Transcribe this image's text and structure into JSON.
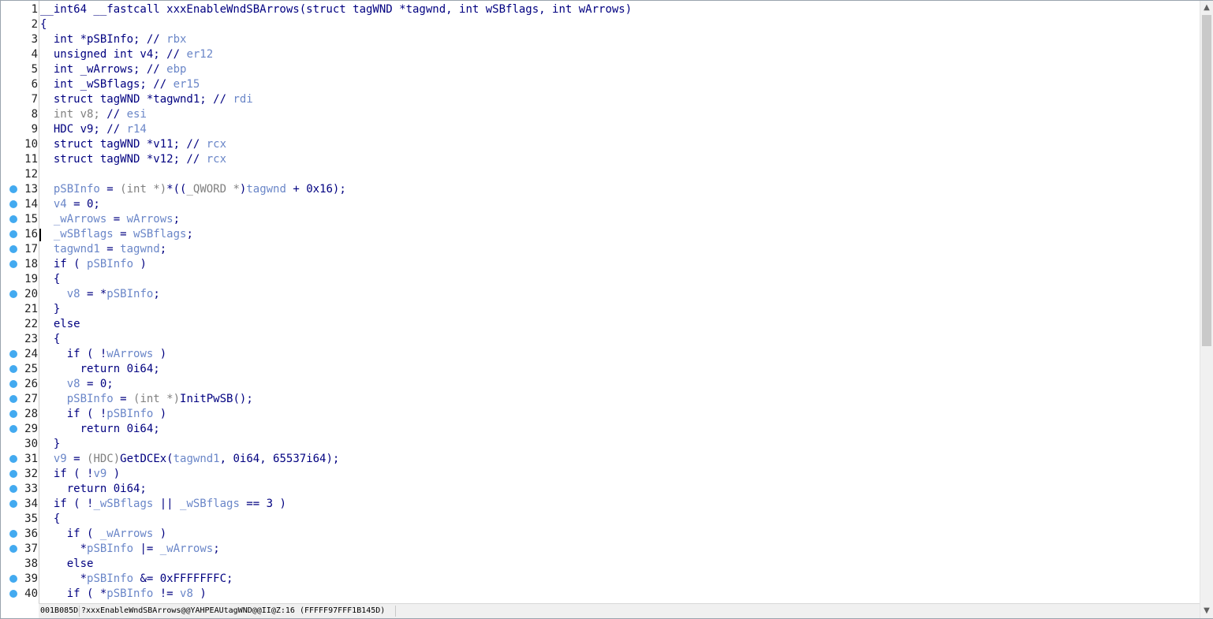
{
  "editor": {
    "lines": [
      {
        "n": "1",
        "bp": false,
        "tokens": [
          [
            "k",
            "__int64 __fastcall xxxEnableWndSBArrows(struct tagWND *tagwnd, int wSBflags, int wArrows)"
          ]
        ]
      },
      {
        "n": "2",
        "bp": false,
        "tokens": [
          [
            "k",
            "{"
          ]
        ]
      },
      {
        "n": "3",
        "bp": false,
        "tokens": [
          [
            "k",
            "  int *pSBInfo; // "
          ],
          [
            "c",
            "rbx"
          ]
        ]
      },
      {
        "n": "4",
        "bp": false,
        "tokens": [
          [
            "k",
            "  unsigned int v4; // "
          ],
          [
            "c",
            "er12"
          ]
        ]
      },
      {
        "n": "5",
        "bp": false,
        "tokens": [
          [
            "k",
            "  int _wArrows; // "
          ],
          [
            "c",
            "ebp"
          ]
        ]
      },
      {
        "n": "6",
        "bp": false,
        "tokens": [
          [
            "k",
            "  int _wSBflags; // "
          ],
          [
            "c",
            "er15"
          ]
        ]
      },
      {
        "n": "7",
        "bp": false,
        "tokens": [
          [
            "k",
            "  struct tagWND *tagwnd1; // "
          ],
          [
            "c",
            "rdi"
          ]
        ]
      },
      {
        "n": "8",
        "bp": false,
        "tokens": [
          [
            "d",
            "  int v8; "
          ],
          [
            "k",
            "// "
          ],
          [
            "c",
            "esi"
          ]
        ]
      },
      {
        "n": "9",
        "bp": false,
        "tokens": [
          [
            "k",
            "  HDC v9; // "
          ],
          [
            "c",
            "r14"
          ]
        ]
      },
      {
        "n": "10",
        "bp": false,
        "tokens": [
          [
            "k",
            "  struct tagWND *v11; // "
          ],
          [
            "c",
            "rcx"
          ]
        ]
      },
      {
        "n": "11",
        "bp": false,
        "tokens": [
          [
            "k",
            "  struct tagWND *v12; // "
          ],
          [
            "c",
            "rcx"
          ]
        ]
      },
      {
        "n": "12",
        "bp": false,
        "tokens": [
          [
            "k",
            ""
          ]
        ]
      },
      {
        "n": "13",
        "bp": true,
        "tokens": [
          [
            "v",
            "  pSBInfo"
          ],
          [
            "k",
            " = "
          ],
          [
            "d",
            "(int *)"
          ],
          [
            "k",
            "*(("
          ],
          [
            "d",
            "_QWORD *"
          ],
          [
            "k",
            ")"
          ],
          [
            "v",
            "tagwnd"
          ],
          [
            "k",
            " + 0x16);"
          ]
        ]
      },
      {
        "n": "14",
        "bp": true,
        "tokens": [
          [
            "v",
            "  v4"
          ],
          [
            "k",
            " = 0;"
          ]
        ]
      },
      {
        "n": "15",
        "bp": true,
        "tokens": [
          [
            "v",
            "  _wArrows"
          ],
          [
            "k",
            " = "
          ],
          [
            "v",
            "wArrows"
          ],
          [
            "k",
            ";"
          ]
        ]
      },
      {
        "n": "16",
        "bp": true,
        "tokens": [
          [
            "v",
            "  _wSBflags"
          ],
          [
            "k",
            " = "
          ],
          [
            "v",
            "wSBflags"
          ],
          [
            "k",
            ";"
          ]
        ]
      },
      {
        "n": "17",
        "bp": true,
        "tokens": [
          [
            "v",
            "  tagwnd1"
          ],
          [
            "k",
            " = "
          ],
          [
            "v",
            "tagwnd"
          ],
          [
            "k",
            ";"
          ]
        ]
      },
      {
        "n": "18",
        "bp": true,
        "tokens": [
          [
            "k",
            "  if ( "
          ],
          [
            "v",
            "pSBInfo"
          ],
          [
            "k",
            " )"
          ]
        ]
      },
      {
        "n": "19",
        "bp": false,
        "tokens": [
          [
            "k",
            "  {"
          ]
        ]
      },
      {
        "n": "20",
        "bp": true,
        "tokens": [
          [
            "v",
            "    v8"
          ],
          [
            "k",
            " = *"
          ],
          [
            "v",
            "pSBInfo"
          ],
          [
            "k",
            ";"
          ]
        ]
      },
      {
        "n": "21",
        "bp": false,
        "tokens": [
          [
            "k",
            "  }"
          ]
        ]
      },
      {
        "n": "22",
        "bp": false,
        "tokens": [
          [
            "k",
            "  else"
          ]
        ]
      },
      {
        "n": "23",
        "bp": false,
        "tokens": [
          [
            "k",
            "  {"
          ]
        ]
      },
      {
        "n": "24",
        "bp": true,
        "tokens": [
          [
            "k",
            "    if ( !"
          ],
          [
            "v",
            "wArrows"
          ],
          [
            "k",
            " )"
          ]
        ]
      },
      {
        "n": "25",
        "bp": true,
        "tokens": [
          [
            "k",
            "      return 0i64;"
          ]
        ]
      },
      {
        "n": "26",
        "bp": true,
        "tokens": [
          [
            "v",
            "    v8"
          ],
          [
            "k",
            " = 0;"
          ]
        ]
      },
      {
        "n": "27",
        "bp": true,
        "tokens": [
          [
            "v",
            "    pSBInfo"
          ],
          [
            "k",
            " = "
          ],
          [
            "d",
            "(int *)"
          ],
          [
            "k",
            "InitPwSB();"
          ]
        ]
      },
      {
        "n": "28",
        "bp": true,
        "tokens": [
          [
            "k",
            "    if ( !"
          ],
          [
            "v",
            "pSBInfo"
          ],
          [
            "k",
            " )"
          ]
        ]
      },
      {
        "n": "29",
        "bp": true,
        "tokens": [
          [
            "k",
            "      return 0i64;"
          ]
        ]
      },
      {
        "n": "30",
        "bp": false,
        "tokens": [
          [
            "k",
            "  }"
          ]
        ]
      },
      {
        "n": "31",
        "bp": true,
        "tokens": [
          [
            "v",
            "  v9"
          ],
          [
            "k",
            " = "
          ],
          [
            "d",
            "(HDC)"
          ],
          [
            "k",
            "GetDCEx("
          ],
          [
            "v",
            "tagwnd1"
          ],
          [
            "k",
            ", 0i64, 65537i64);"
          ]
        ]
      },
      {
        "n": "32",
        "bp": true,
        "tokens": [
          [
            "k",
            "  if ( !"
          ],
          [
            "v",
            "v9"
          ],
          [
            "k",
            " )"
          ]
        ]
      },
      {
        "n": "33",
        "bp": true,
        "tokens": [
          [
            "k",
            "    return 0i64;"
          ]
        ]
      },
      {
        "n": "34",
        "bp": true,
        "tokens": [
          [
            "k",
            "  if ( !"
          ],
          [
            "v",
            "_wSBflags"
          ],
          [
            "k",
            " || "
          ],
          [
            "v",
            "_wSBflags"
          ],
          [
            "k",
            " == 3 )"
          ]
        ]
      },
      {
        "n": "35",
        "bp": false,
        "tokens": [
          [
            "k",
            "  {"
          ]
        ]
      },
      {
        "n": "36",
        "bp": true,
        "tokens": [
          [
            "k",
            "    if ( "
          ],
          [
            "v",
            "_wArrows"
          ],
          [
            "k",
            " )"
          ]
        ]
      },
      {
        "n": "37",
        "bp": true,
        "tokens": [
          [
            "k",
            "      *"
          ],
          [
            "v",
            "pSBInfo"
          ],
          [
            "k",
            " |= "
          ],
          [
            "v",
            "_wArrows"
          ],
          [
            "k",
            ";"
          ]
        ]
      },
      {
        "n": "38",
        "bp": false,
        "tokens": [
          [
            "k",
            "    else"
          ]
        ]
      },
      {
        "n": "39",
        "bp": true,
        "tokens": [
          [
            "k",
            "      *"
          ],
          [
            "v",
            "pSBInfo"
          ],
          [
            "k",
            " &= 0xFFFFFFFC;"
          ]
        ]
      },
      {
        "n": "40",
        "bp": true,
        "tokens": [
          [
            "k",
            "    if ( *"
          ],
          [
            "v",
            "pSBInfo"
          ],
          [
            "k",
            " != "
          ],
          [
            "v",
            "v8"
          ],
          [
            "k",
            " )"
          ]
        ]
      }
    ]
  },
  "scrollbar": {
    "up_arrow": "▲",
    "down_arrow": "▼"
  },
  "statusbar": {
    "address": "001B085D",
    "location": "?xxxEnableWndSBArrows@@YAHPEAUtagWND@@II@Z:16 (FFFFF97FFF1B145D)"
  },
  "colors": {
    "breakpoint": "#43aaf0",
    "keyword": "#000080",
    "variable": "#6a86c8",
    "dim": "#808080"
  },
  "icons": {
    "breakpoint": "breakpoint-dot-icon",
    "scroll_up": "scroll-up-arrow-icon",
    "scroll_down": "scroll-down-arrow-icon"
  }
}
